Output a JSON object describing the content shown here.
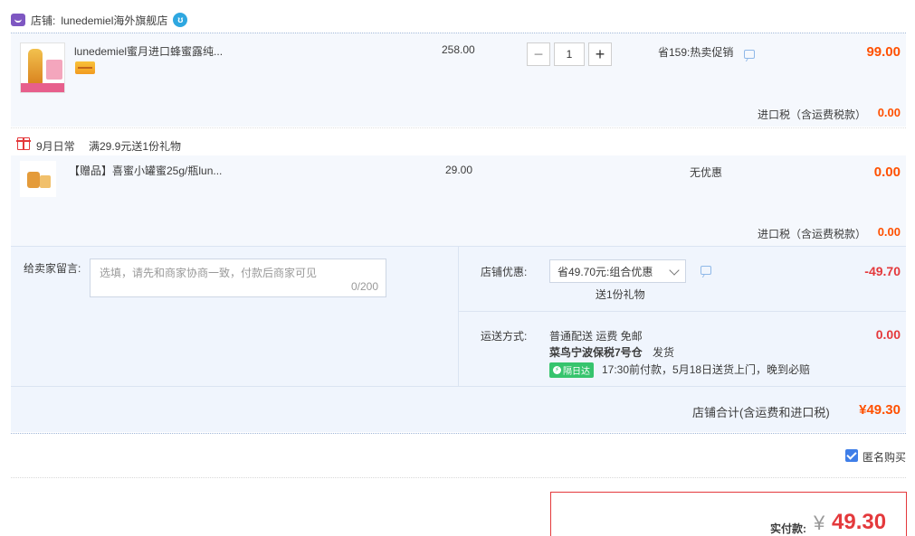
{
  "store": {
    "label": "店铺:",
    "name": "lunedemiel海外旗舰店"
  },
  "item1": {
    "title": "lunedemiel蜜月进口蜂蜜露纯...",
    "price": "258.00",
    "quantity": "1",
    "minus": "−",
    "plus": "+",
    "promo": "省159:热卖促销",
    "subtotal": "99.00",
    "tax_label": "进口税（含运费税款）",
    "tax_value": "0.00"
  },
  "gift_promo": {
    "tag": "9月日常",
    "text": "满29.9元送1份礼物"
  },
  "item2": {
    "title": "【赠品】喜蜜小罐蜜25g/瓶lun...",
    "price": "29.00",
    "promo": "无优惠",
    "subtotal": "0.00",
    "tax_label": "进口税（含运费税款）",
    "tax_value": "0.00"
  },
  "message": {
    "label": "给卖家留言:",
    "placeholder": "选填，请先和商家协商一致，付款后商家可见",
    "counter": "0/200"
  },
  "discount": {
    "label": "店铺优惠:",
    "selected": "省49.70元:组合优惠",
    "gift": "送1份礼物",
    "value": "-49.70"
  },
  "shipping": {
    "label": "运送方式:",
    "method": "普通配送 运费 免邮",
    "warehouse": "菜鸟宁波保税7号仓",
    "ship_text": "发货",
    "badge": "隔日达",
    "badge_icon": "⚡",
    "eta": "17:30前付款，5月18日送货上门，晚到必赔",
    "value": "0.00"
  },
  "store_total": {
    "label": "店铺合计(含运费和进口税)",
    "value": "¥49.30"
  },
  "anonymous": {
    "label": "匿名购买",
    "checked": true
  },
  "payment": {
    "label": "实付款:",
    "currency": "¥",
    "value": "49.30"
  }
}
